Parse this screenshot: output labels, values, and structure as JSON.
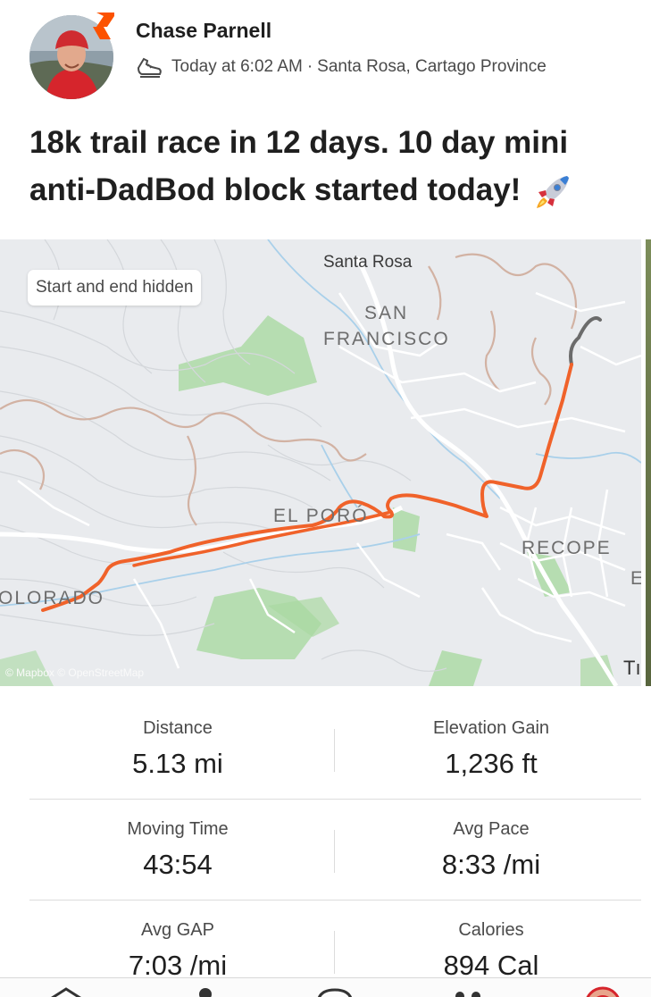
{
  "header": {
    "user_name": "Chase Parnell",
    "timestamp": "Today at 6:02 AM",
    "separator": "·",
    "location": "Santa Rosa, Cartago Province",
    "activity_icon": "shoe-icon",
    "badge_color": "#fc5200"
  },
  "activity": {
    "title": "18k trail race in 12 days. 10 day mini anti-DadBod block started today!",
    "emoji": "rocket-emoji"
  },
  "map": {
    "privacy_label": "Start and end hidden",
    "labels": {
      "santa_rosa": "Santa Rosa",
      "san": "SAN",
      "francisco": "FRANCISCO",
      "el_poro": "EL PORÓ",
      "recope": "RECOPE",
      "colorado": "OLORADO",
      "edge_e": "E",
      "edge_t": "Tı"
    },
    "attribution": "© Mapbox © OpenStreetMap",
    "route_color": "#f0622a"
  },
  "stats": {
    "distance": {
      "label": "Distance",
      "value": "5.13 mi"
    },
    "elevation": {
      "label": "Elevation Gain",
      "value": "1,236 ft"
    },
    "moving_time": {
      "label": "Moving Time",
      "value": "43:54"
    },
    "avg_pace": {
      "label": "Avg Pace",
      "value": "8:33 /mi"
    },
    "avg_gap": {
      "label": "Avg GAP",
      "value": "7:03 /mi"
    },
    "calories": {
      "label": "Calories",
      "value": "894 Cal"
    }
  },
  "tabbar": {
    "icons": [
      "home-icon",
      "maps-icon",
      "record-icon",
      "groups-icon",
      "you-icon"
    ]
  }
}
